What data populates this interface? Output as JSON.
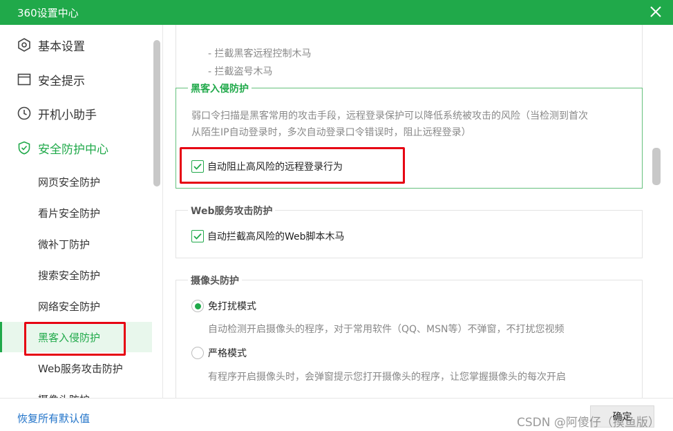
{
  "window": {
    "title": "360设置中心"
  },
  "sidebar": {
    "main_items": [
      {
        "label": "基本设置",
        "icon": "hexagon-gear-icon"
      },
      {
        "label": "安全提示",
        "icon": "window-icon"
      },
      {
        "label": "开机小助手",
        "icon": "clock-icon"
      },
      {
        "label": "安全防护中心",
        "icon": "shield-check-icon"
      }
    ],
    "sub_items": [
      {
        "label": "网页安全防护"
      },
      {
        "label": "看片安全防护"
      },
      {
        "label": "微补丁防护"
      },
      {
        "label": "搜索安全防护"
      },
      {
        "label": "网络安全防护"
      },
      {
        "label": "黑客入侵防护"
      },
      {
        "label": "Web服务攻击防护"
      },
      {
        "label": "摄像头防护"
      }
    ]
  },
  "content": {
    "top_section": {
      "lines": [
        "- 拦截黑客远程控制木马",
        "- 拦截盗号木马"
      ]
    },
    "hacker_section": {
      "title": "黑客入侵防护",
      "description_lines": [
        "弱口令扫描是黑客常用的攻击手段，远程登录保护可以降低系统被攻击的风险（当检测到首次",
        "从陌生IP自动登录时，多次自动登录口令错误时，阻止远程登录）"
      ],
      "checkbox_label": "自动阻止高风险的远程登录行为"
    },
    "web_section": {
      "title": "Web服务攻击防护",
      "checkbox_label": "自动拦截高风险的Web脚本木马"
    },
    "camera_section": {
      "title": "摄像头防护",
      "options": [
        {
          "label": "免打扰模式",
          "description": "自动检测开启摄像头的程序，对于常用软件（QQ、MSN等）不弹窗，不打扰您视频"
        },
        {
          "label": "严格模式",
          "description": "有程序开启摄像头时，会弹窗提示您打开摄像头的程序，让您掌握摄像头的每次开启"
        }
      ]
    }
  },
  "footer": {
    "reset_label": "恢复所有默认值",
    "ok_label": "确定",
    "watermark": "CSDN @阿傻仔（摸鱼版）"
  },
  "colors": {
    "brand": "#20a94a",
    "highlight": "#e60012",
    "link": "#1f72c8"
  }
}
